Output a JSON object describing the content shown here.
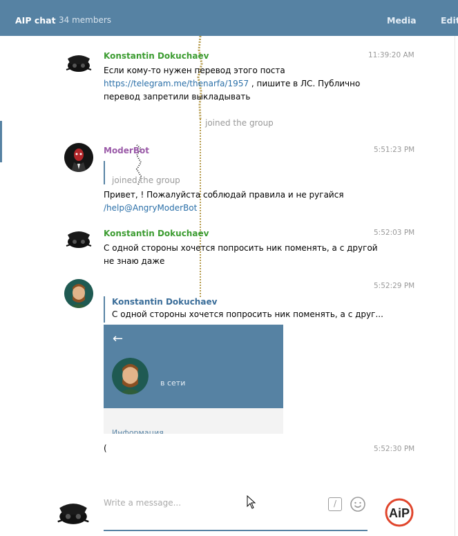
{
  "header": {
    "title": "AIP chat",
    "members": "34 members",
    "media": "Media",
    "edit": "Edit"
  },
  "messages": [
    {
      "author": "Konstantin Dokuchaev",
      "time": "11:39:20 AM",
      "line1": "Если кому-то нужен перевод этого поста",
      "link": "https://telegram.me/thenarfa/1957",
      "line2_rest": " , пишите в ЛС. Публично",
      "line3": "перевод запретили выкладывать"
    },
    {
      "service": "joined the group"
    },
    {
      "author": "ModerBot",
      "time": "5:51:23 PM",
      "quote_text": "joined the group",
      "line1": "Привет, ! Пожалуйста соблюдай правила и не ругайся",
      "link": "/help@AngryModerBot"
    },
    {
      "author": "Konstantin Dokuchaev",
      "time": "5:52:03 PM",
      "line1": "С одной стороны хочется попросить ник поменять, а с другой",
      "line2": "не знаю даже"
    },
    {
      "time": "5:52:29 PM",
      "reply_author": "Konstantin Dokuchaev",
      "reply_text": "С одной стороны хочется попросить ник поменять, а с друг...",
      "screenshot_status": "в сети",
      "screenshot_info": "Информация"
    },
    {
      "time": "5:52:30 PM",
      "text": "("
    }
  ],
  "composer": {
    "placeholder": "Write a message..."
  },
  "logo_text": "AiP",
  "colors": {
    "header_bg": "#5682a3",
    "author_green": "#3c9c31",
    "author_purple": "#9a5aa8",
    "link": "#2a6fa8",
    "logo_red": "#e0452c"
  },
  "icons": [
    "commands-icon",
    "emoji-icon",
    "mouse-cursor-icon",
    "back-arrow-icon"
  ]
}
